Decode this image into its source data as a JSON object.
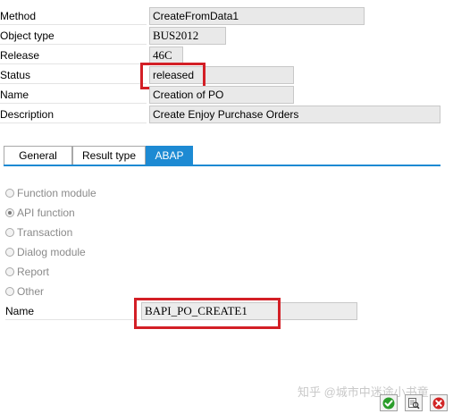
{
  "details": {
    "method": {
      "label": "Method",
      "value": "CreateFromData1"
    },
    "object_type": {
      "label": "Object type",
      "value": "BUS2012"
    },
    "release": {
      "label": "Release",
      "value": "46C"
    },
    "status": {
      "label": "Status",
      "value": "released"
    },
    "name": {
      "label": "Name",
      "value": "Creation of PO"
    },
    "description": {
      "label": "Description",
      "value": "Create Enjoy Purchase Orders"
    }
  },
  "tabs": [
    {
      "label": "General"
    },
    {
      "label": "Result type"
    },
    {
      "label": "ABAP",
      "active": true
    }
  ],
  "abap": {
    "options": [
      {
        "label": "Function module",
        "selected": false
      },
      {
        "label": "API function",
        "selected": true
      },
      {
        "label": "Transaction",
        "selected": false
      },
      {
        "label": "Dialog module",
        "selected": false
      },
      {
        "label": "Report",
        "selected": false
      },
      {
        "label": "Other",
        "selected": false
      }
    ],
    "name_label": "Name",
    "name_value": "BAPI_PO_CREATE1"
  },
  "watermark": "知乎 @城市中迷途小书童",
  "colors": {
    "accent": "#1d8ad3",
    "highlight": "#d31f26",
    "confirm": "#2a9d2a",
    "cancel": "#d12424"
  },
  "icons": {
    "confirm": "checkmark-icon",
    "inspect": "magnifier-icon",
    "cancel": "close-icon"
  }
}
